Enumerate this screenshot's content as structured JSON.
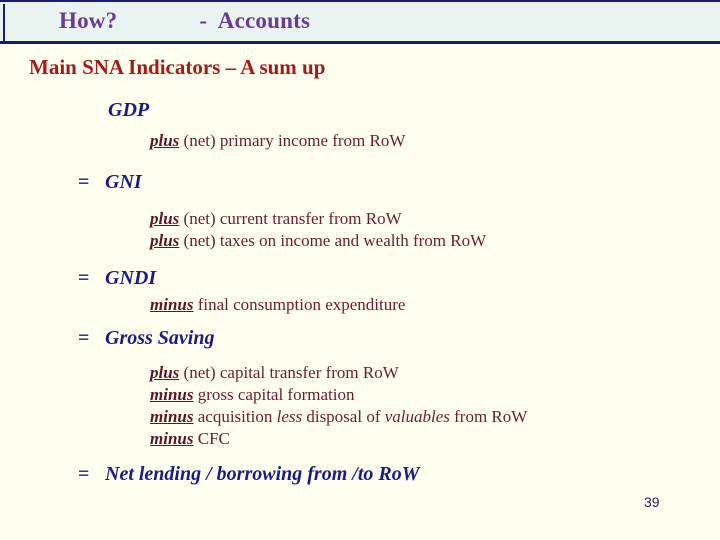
{
  "slide": {
    "background_color": "#FFFFF0",
    "page_number": "39"
  },
  "header": {
    "background_color": "#E9F4F0",
    "border_color": "#1B1B6B",
    "title_color": "#6A3B96",
    "title_left": "How?",
    "title_right": "-  Accounts"
  },
  "section": {
    "heading": "Main SNA Indicators – A sum up",
    "heading_color": "#A51919"
  },
  "equation": {
    "aggregate_color": "#1A1A8C",
    "operand_color": "#6B1B32",
    "lines": [
      {
        "type": "term",
        "label": "GDP"
      },
      {
        "type": "operand",
        "op": "plus",
        "rest": " (net) primary income from RoW"
      },
      {
        "type": "total",
        "sign": "=",
        "label": "GNI"
      },
      {
        "type": "operand",
        "op": "plus",
        "rest": " (net) current transfer from RoW"
      },
      {
        "type": "operand",
        "op": "plus",
        "rest": " (net) taxes on income and wealth from RoW"
      },
      {
        "type": "total",
        "sign": "=",
        "label": "GNDI"
      },
      {
        "type": "operand",
        "op": "minus",
        "rest": " final consumption expenditure"
      },
      {
        "type": "total",
        "sign": "=",
        "label": "Gross Saving"
      },
      {
        "type": "operand",
        "op": "plus",
        "rest": " (net) capital transfer from RoW"
      },
      {
        "type": "operand",
        "op": "minus",
        "rest": " gross capital formation"
      },
      {
        "type": "operand",
        "op": "minus",
        "rest_a": " acquisition ",
        "em_a": "less",
        "rest_b": " disposal of ",
        "em_b": "valuables",
        "rest_c": " from RoW"
      },
      {
        "type": "operand",
        "op": "minus",
        "rest": " CFC"
      },
      {
        "type": "total",
        "sign": "=",
        "label": "Net lending / borrowing from /to RoW"
      }
    ]
  }
}
